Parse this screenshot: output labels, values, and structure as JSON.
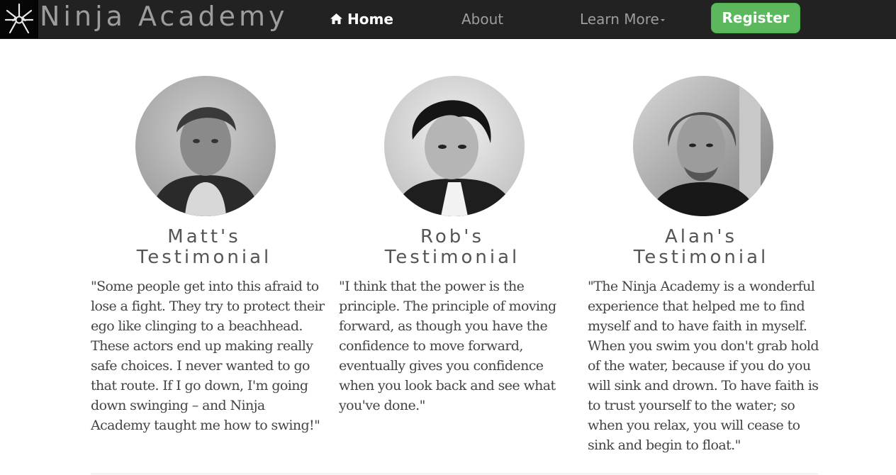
{
  "brand": {
    "title": "Ninja Academy",
    "logo_icon": "ninja-star-icon"
  },
  "nav": {
    "home_label": "Home",
    "home_icon": "home-icon",
    "about_label": "About",
    "learn_more_label": "Learn More",
    "register_label": "Register"
  },
  "colors": {
    "navbar_bg": "#222222",
    "nav_text": "#9d9d9d",
    "register_bg": "#5cb85c",
    "heading": "#555555",
    "body_text": "#444444"
  },
  "testimonials": [
    {
      "title_line1": "Matt's",
      "title_line2": "Testimonial",
      "quote": "\"Some people get into this afraid to lose a fight. They try to protect their ego like clinging to a beachhead. These actors end up making really safe choices. I never wanted to go that route. If I go down, I'm going down swinging – and Ninja Academy taught me how to swing!\""
    },
    {
      "title_line1": "Rob's",
      "title_line2": "Testimonial",
      "quote": "\"I think that the power is the principle. The principle of moving forward, as though you have the confidence to move forward, eventually gives you confidence when you look back and see what you've done.\""
    },
    {
      "title_line1": "Alan's",
      "title_line2": "Testimonial",
      "quote": "\"The Ninja Academy is a wonderful experience that helped me to find myself and to have faith in myself. When you swim you don't grab hold of the water, because if you do you will sink and drown. To have faith is to trust yourself to the water; so when you relax, you will cease to sink and begin to float.\""
    }
  ]
}
